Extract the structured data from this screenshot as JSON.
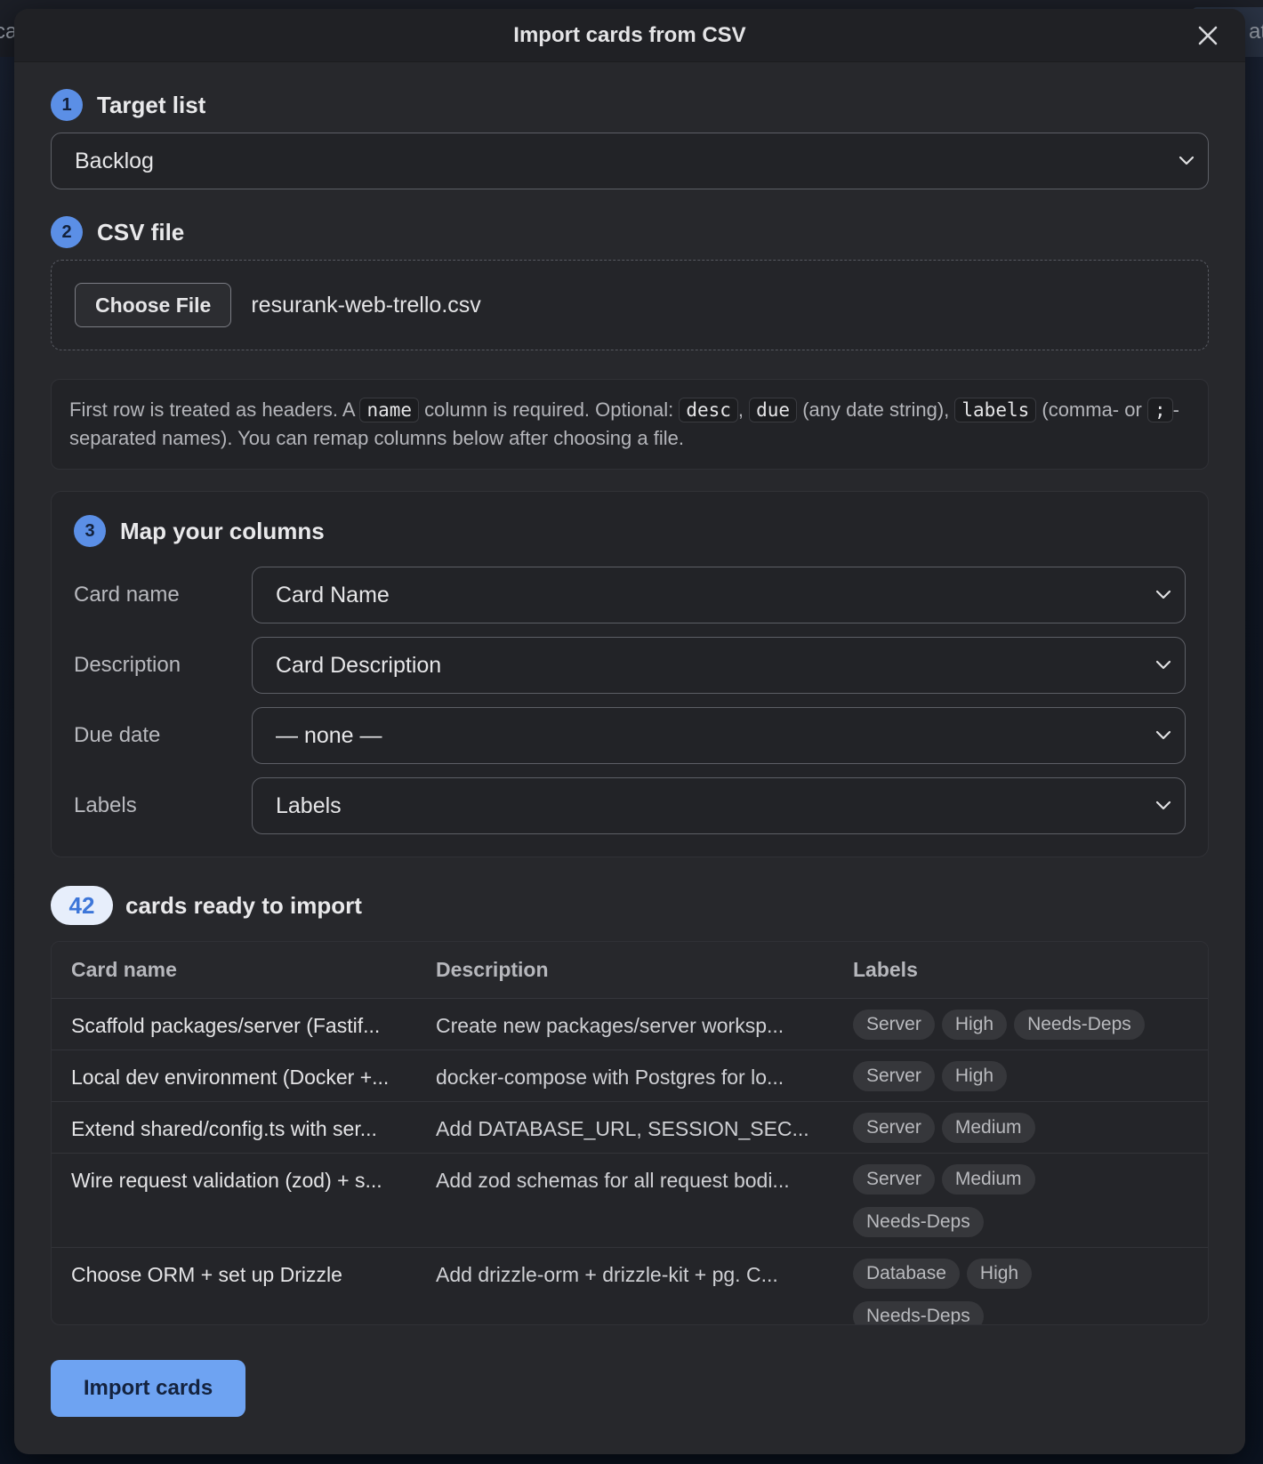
{
  "background": {
    "left_text": "ca",
    "right_text": "at"
  },
  "dialog": {
    "title": "Import cards from CSV"
  },
  "step1": {
    "number": "1",
    "title": "Target list",
    "select_value": "Backlog"
  },
  "step2": {
    "number": "2",
    "title": "CSV file",
    "choose_label": "Choose File",
    "file_name": "resurank-web-trello.csv"
  },
  "info": {
    "t1": "First row is treated as headers. A ",
    "code_name": "name",
    "t2": " column is required. Optional: ",
    "code_desc": "desc",
    "t3": ", ",
    "code_due": "due",
    "t4": " (any date string), ",
    "code_labels": "labels",
    "t5": " (comma- or ",
    "code_semicolon": ";",
    "t6": "-separated names). You can remap columns below after choosing a file."
  },
  "step3": {
    "number": "3",
    "title": "Map your columns",
    "rows": [
      {
        "label": "Card name",
        "value": "Card Name"
      },
      {
        "label": "Description",
        "value": "Card Description"
      },
      {
        "label": "Due date",
        "value": "— none —"
      },
      {
        "label": "Labels",
        "value": "Labels"
      }
    ]
  },
  "ready": {
    "count": "42",
    "text": "cards ready to import"
  },
  "table": {
    "headers": [
      "Card name",
      "Description",
      "Labels"
    ],
    "rows": [
      {
        "name": "Scaffold packages/server (Fastif...",
        "desc": "Create new packages/server worksp...",
        "labels": [
          "Server",
          "High",
          "Needs-Deps"
        ]
      },
      {
        "name": "Local dev environment (Docker +...",
        "desc": "docker-compose with Postgres for lo...",
        "labels": [
          "Server",
          "High"
        ]
      },
      {
        "name": "Extend shared/config.ts with ser...",
        "desc": "Add DATABASE_URL, SESSION_SEC...",
        "labels": [
          "Server",
          "Medium"
        ]
      },
      {
        "name": "Wire request validation (zod) + s...",
        "desc": "Add zod schemas for all request bodi...",
        "labels": [
          "Server",
          "Medium",
          "Needs-Deps"
        ]
      },
      {
        "name": "Choose ORM + set up Drizzle",
        "desc": "Add drizzle-orm + drizzle-kit + pg. C...",
        "labels": [
          "Database",
          "High",
          "Needs-Deps"
        ]
      }
    ]
  },
  "actions": {
    "import_label": "Import cards"
  }
}
